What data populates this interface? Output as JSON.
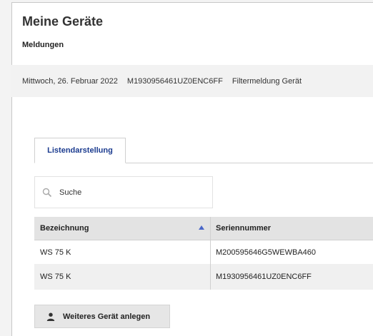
{
  "page": {
    "title": "Meine Geräte"
  },
  "messages": {
    "section_title": "Meldungen",
    "items": [
      {
        "date": "Mittwoch, 26. Februar 2022",
        "serial": "M1930956461UZ0ENC6FF",
        "type": "Filtermeldung Gerät"
      }
    ]
  },
  "tabs": [
    {
      "label": "Listendarstellung",
      "active": true
    }
  ],
  "search": {
    "placeholder": "Suche",
    "icon": "search-icon"
  },
  "table": {
    "columns": [
      {
        "label": "Bezeichnung",
        "sorted": "ascending"
      },
      {
        "label": "Seriennummer"
      }
    ],
    "rows": [
      {
        "name": "WS 75 K",
        "serial": "M200595646G5WEWBA460"
      },
      {
        "name": "WS 75 K",
        "serial": "M1930956461UZ0ENC6FF"
      }
    ]
  },
  "actions": {
    "add_device_label": "Weiteres Gerät anlegen",
    "add_device_icon": "person-icon"
  },
  "colors": {
    "accent": "#1b3b8f",
    "sort_indicator": "#4a67c8"
  }
}
